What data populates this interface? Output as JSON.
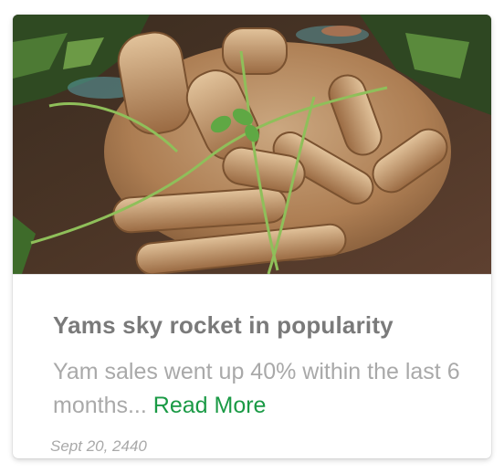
{
  "card": {
    "image_alt": "Harvested yam roots",
    "title": "Yams sky rocket in popularity",
    "excerpt": "Yam sales went up 40% within the last 6 months...",
    "read_more": "Read More",
    "date": "Sept 20, 2440",
    "colors": {
      "title": "#7a7a7a",
      "text": "#a9a9a9",
      "link": "#1a9a45"
    }
  }
}
